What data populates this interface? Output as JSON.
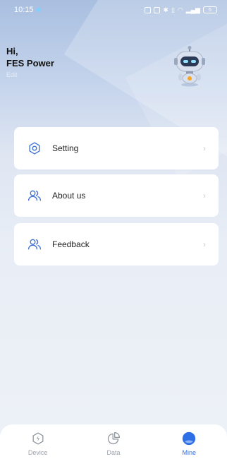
{
  "status_bar": {
    "time": "10:15",
    "battery": "5"
  },
  "header": {
    "greeting": "Hi,",
    "user_name": "FES Power",
    "edit_label": "Edit"
  },
  "menu": [
    {
      "id": "setting",
      "label": "Setting",
      "icon": "gear-icon"
    },
    {
      "id": "about",
      "label": "About us",
      "icon": "users-icon"
    },
    {
      "id": "feedback",
      "label": "Feedback",
      "icon": "users-icon"
    }
  ],
  "tabs": [
    {
      "id": "device",
      "label": "Device",
      "icon": "device-icon",
      "active": false
    },
    {
      "id": "data",
      "label": "Data",
      "icon": "pie-chart-icon",
      "active": false
    },
    {
      "id": "mine",
      "label": "Mine",
      "icon": "profile-icon",
      "active": true
    }
  ],
  "colors": {
    "accent": "#2f6fe6",
    "icon_blue": "#3b6fd8",
    "inactive": "#9aa0aa"
  }
}
